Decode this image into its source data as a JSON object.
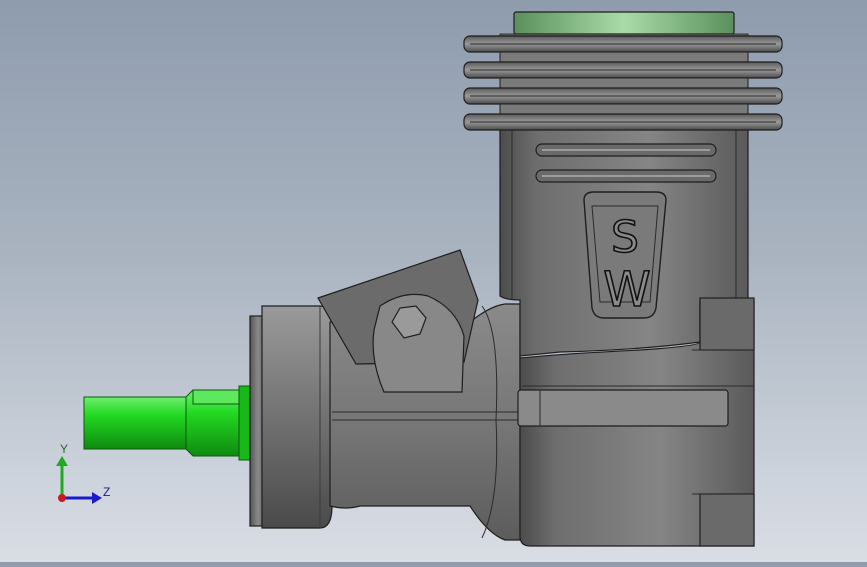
{
  "view": {
    "background_top": "#8f9cae",
    "background_bottom": "#d9dde4",
    "model_color": "#7d7d7d",
    "model_edge_color": "#1e1e1e",
    "shaft_color": "#22d822",
    "cylinder_head_color": "#8fcb8f"
  },
  "model": {
    "logo_top_letter": "S",
    "logo_bottom_letter": "W"
  },
  "triad": {
    "y_label": "Y",
    "z_label": "Z",
    "y_color": "#1faa1f",
    "z_color": "#1a1acc",
    "origin_color": "#cc1a1a"
  }
}
